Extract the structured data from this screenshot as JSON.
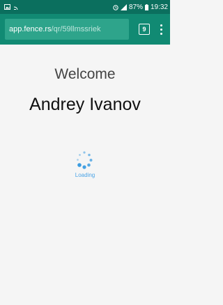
{
  "status_bar": {
    "battery": "87%",
    "time": "19:32"
  },
  "browser": {
    "url_host": "app.fence.rs",
    "url_path": "/qr/59llmssriek",
    "tab_count": "9"
  },
  "page": {
    "welcome": "Welcome",
    "user_name": "Andrey Ivanov",
    "loading": "Loading"
  },
  "colors": {
    "status_bar": "#0b6f5e",
    "toolbar": "#118a73",
    "spinner": "#3a9be0"
  },
  "icons": {
    "status_left": [
      "gallery-icon",
      "cast-icon"
    ],
    "status_right": [
      "alarm-icon",
      "signal-icon",
      "battery-icon"
    ],
    "toolbar": [
      "tabs-icon",
      "more-vert-icon"
    ]
  }
}
